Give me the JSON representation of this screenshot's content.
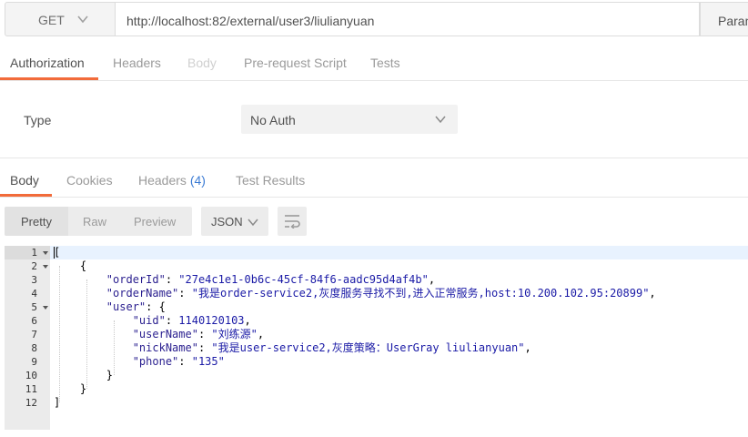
{
  "request": {
    "method": "GET",
    "url": "http://localhost:82/external/user3/liulianyuan",
    "params_label": "Param"
  },
  "request_tabs": [
    {
      "label": "Authorization",
      "state": "active"
    },
    {
      "label": "Headers",
      "state": "normal"
    },
    {
      "label": "Body",
      "state": "disabled"
    },
    {
      "label": "Pre-request Script",
      "state": "normal"
    },
    {
      "label": "Tests",
      "state": "normal"
    }
  ],
  "auth": {
    "type_label": "Type",
    "selected": "No Auth"
  },
  "response_tabs": {
    "body": "Body",
    "cookies": "Cookies",
    "headers": "Headers",
    "headers_count": "(4)",
    "test_results": "Test Results"
  },
  "toolbar": {
    "views": [
      "Pretty",
      "Raw",
      "Preview"
    ],
    "active_view": "Pretty",
    "format": "JSON"
  },
  "editor": {
    "line_numbers": [
      "1",
      "2",
      "3",
      "4",
      "5",
      "6",
      "7",
      "8",
      "9",
      "10",
      "11",
      "12"
    ],
    "lines": [
      "[",
      "    {",
      "        \"orderId\": \"27e4c1e1-0b6c-45cf-84f6-aadc95d4af4b\",",
      "        \"orderName\": \"我是order-service2,灰度服务寻找不到,进入正常服务,host:10.200.102.95:20899\",",
      "        \"user\": {",
      "            \"uid\": 1140120103,",
      "            \"userName\": \"刘练源\",",
      "            \"nickName\": \"我是user-service2,灰度策略：UserGray liulianyuan\",",
      "            \"phone\": \"135\"",
      "        }",
      "    }",
      "]"
    ]
  },
  "colors": {
    "accent": "#f26b3a",
    "count_blue": "#3b7bd4",
    "json_key": "#2a1f8f",
    "json_value": "#1a1aa6"
  }
}
